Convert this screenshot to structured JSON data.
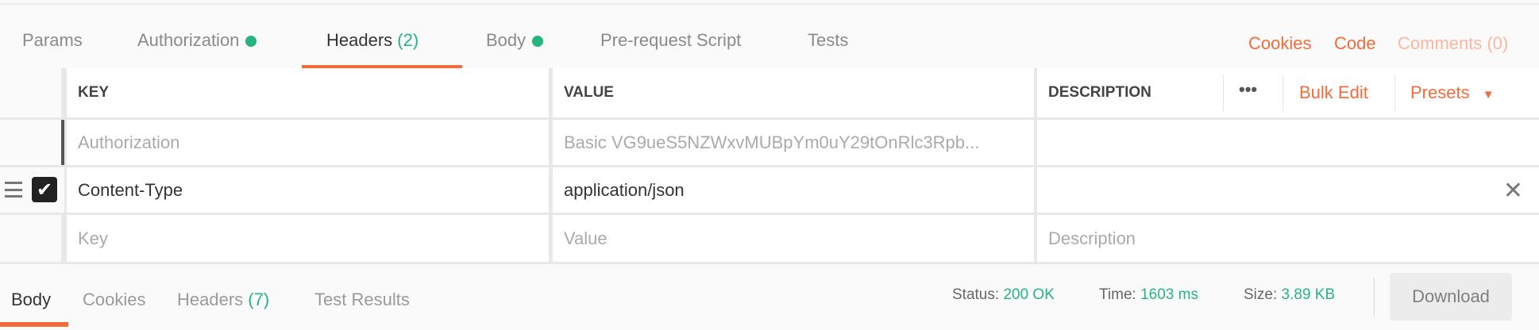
{
  "request_tabs": [
    {
      "label": "Params"
    },
    {
      "label": "Authorization",
      "dot": true
    },
    {
      "label": "Headers",
      "count": "(2)",
      "active": true
    },
    {
      "label": "Body",
      "dot": true
    },
    {
      "label": "Pre-request Script"
    },
    {
      "label": "Tests"
    }
  ],
  "links": {
    "cookies": "Cookies",
    "code": "Code",
    "comments": "Comments (0)"
  },
  "table": {
    "columns": {
      "key": "KEY",
      "value": "VALUE",
      "description": "DESCRIPTION"
    },
    "more_label": "•••",
    "bulk_edit": "Bulk Edit",
    "presets": "Presets",
    "rows": [
      {
        "key": "Authorization",
        "value": "Basic VG9ueS5NZWxvMUBpYm0uY29tOnRlc3Rpb...",
        "description": "",
        "disabled": true
      },
      {
        "key": "Content-Type",
        "value": "application/json",
        "description": "",
        "checked": true
      }
    ],
    "placeholders": {
      "key": "Key",
      "value": "Value",
      "description": "Description"
    }
  },
  "response_tabs": [
    {
      "label": "Body",
      "active": true
    },
    {
      "label": "Cookies"
    },
    {
      "label": "Headers",
      "count": "(7)"
    },
    {
      "label": "Test Results"
    }
  ],
  "status": {
    "status_label": "Status:",
    "status": "200 OK",
    "time_label": "Time:",
    "time": "1603 ms",
    "size_label": "Size:",
    "size": "3.89 KB"
  },
  "download": "Download",
  "colors": {
    "accent": "#f26b3a",
    "success": "#26b47f"
  }
}
